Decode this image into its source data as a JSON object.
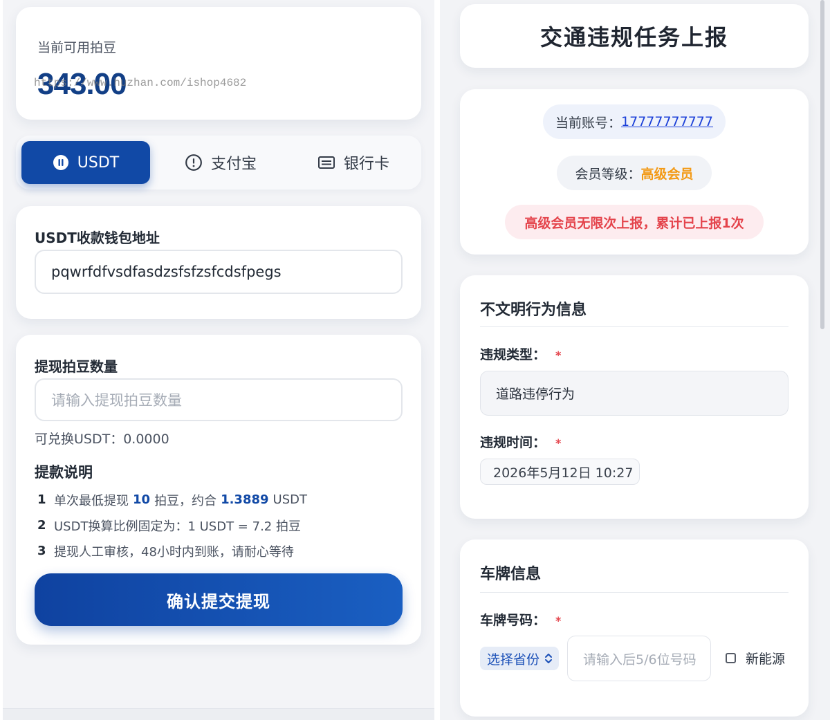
{
  "watermark": "https://www.huzhan.com/ishop4682",
  "withdraw": {
    "balance_label": "当前可用拍豆",
    "balance_value": "343.00",
    "tabs": [
      {
        "label": "USDT",
        "icon": "pause-circle-icon",
        "active": true
      },
      {
        "label": "支付宝",
        "icon": "alert-circle-icon",
        "active": false
      },
      {
        "label": "银行卡",
        "icon": "card-icon",
        "active": false
      }
    ],
    "wallet_label": "USDT收款钱包地址",
    "wallet_value": "pqwrfdfvsdfasdzsfsfzsfcdsfpegs",
    "amount_label": "提现拍豆数量",
    "amount_placeholder": "请输入提现拍豆数量",
    "exchange_text": "可兑换USDT：0.0000",
    "notes_title": "提款说明",
    "notes": [
      {
        "num": "1",
        "pre": "单次最低提现",
        "min": "10",
        "mid": "拍豆，约合",
        "usdt": "1.3889",
        "post": "USDT"
      },
      {
        "num": "2",
        "text": "USDT换算比例固定为：1 USDT = 7.2 拍豆"
      },
      {
        "num": "3",
        "text": "提现人工审核，48小时内到账，请耐心等待"
      }
    ],
    "submit_label": "确认提交提现"
  },
  "report": {
    "title": "交通违规任务上报",
    "account_label": "当前账号：",
    "account_value": "17777777777",
    "level_label": "会员等级：",
    "level_value": "高级会员",
    "notice": "高级会员无限次上报，累计已上报1次",
    "behavior_title": "不文明行为信息",
    "type_label": "违规类型：",
    "type_value": "道路违停行为",
    "time_label": "违规时间：",
    "time_value": "2026年5月12日 10:27",
    "required_mark": "*",
    "plate_title": "车牌信息",
    "plate_label": "车牌号码：",
    "province_value": "选择省份",
    "plate_placeholder": "请输入后5/6位号码",
    "ev_label": "新能源"
  },
  "colors": {
    "primary": "#1149a6",
    "link": "#1a3fd8",
    "level": "#f39a16",
    "danger": "#e4434b"
  }
}
